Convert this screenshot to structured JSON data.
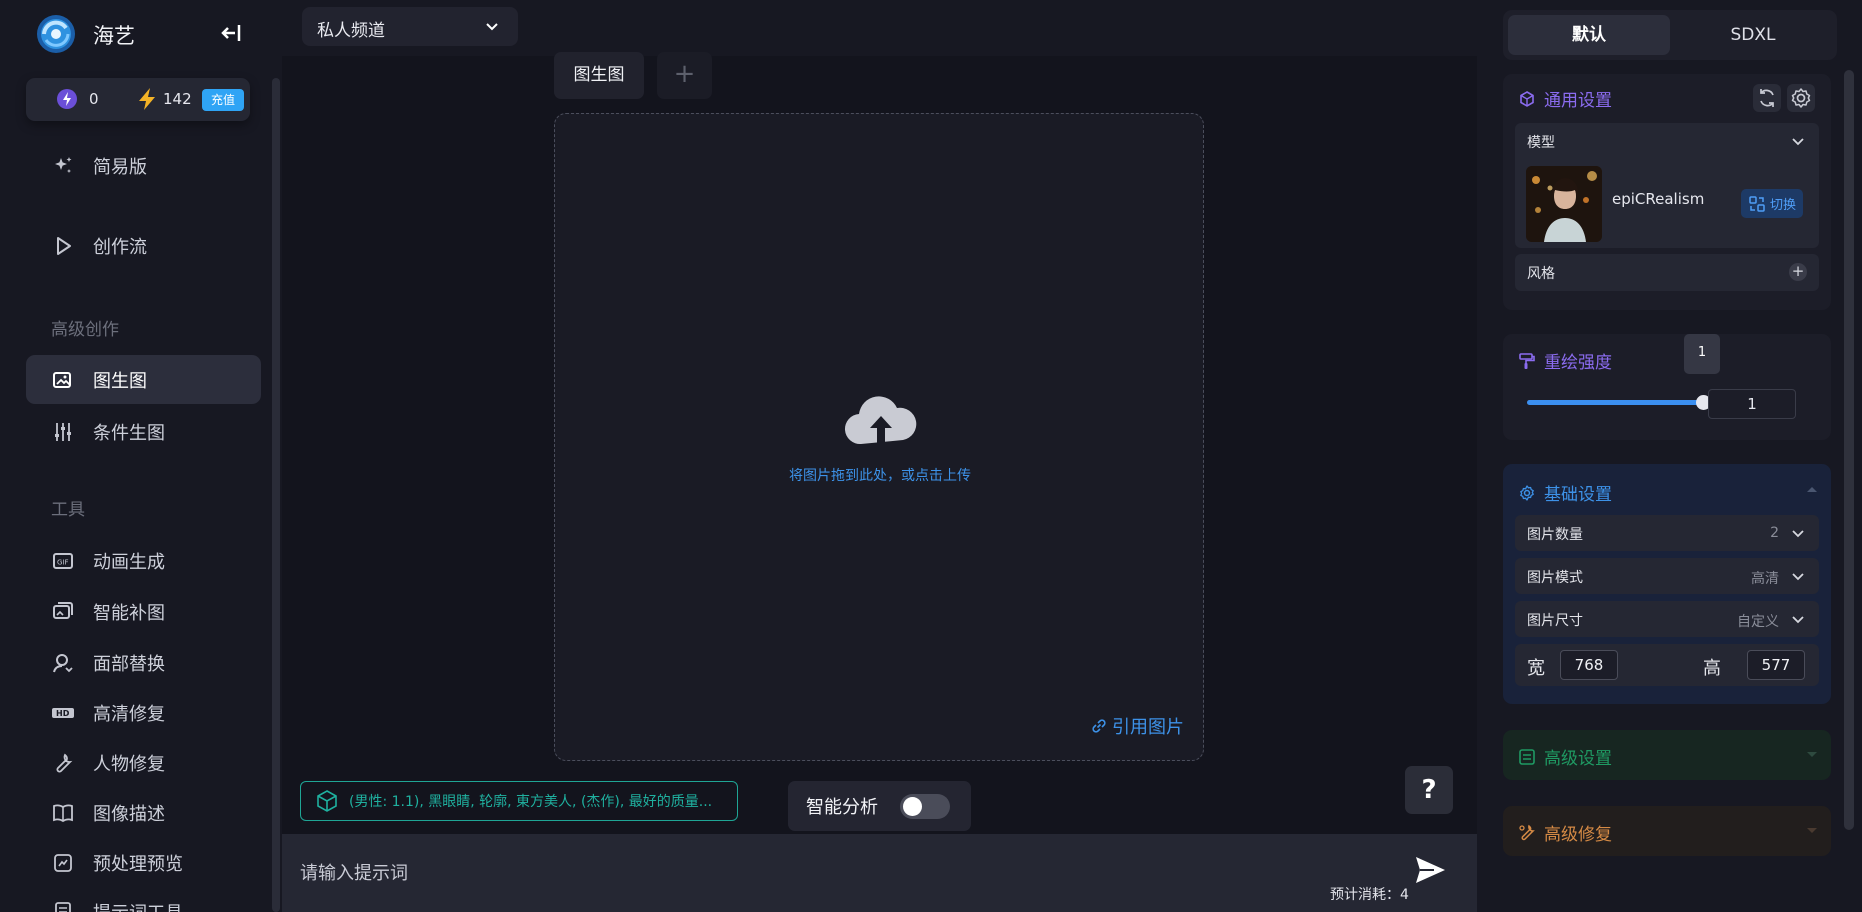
{
  "brand": {
    "name": "海艺"
  },
  "balance": {
    "energy": "0",
    "lightning": "142",
    "recharge_label": "充值"
  },
  "nav": {
    "items": [
      {
        "label": "简易版",
        "icon": "sparkle-icon"
      },
      {
        "label": "创作流",
        "icon": "play-icon"
      }
    ],
    "section_advanced": "高级创作",
    "advanced": [
      {
        "label": "图生图",
        "icon": "image-edit-icon",
        "active": true
      },
      {
        "label": "条件生图",
        "icon": "sliders-icon"
      }
    ],
    "section_tools": "工具",
    "tools": [
      {
        "label": "动画生成",
        "icon": "gif-icon"
      },
      {
        "label": "智能补图",
        "icon": "images-icon"
      },
      {
        "label": "面部替换",
        "icon": "face-icon"
      },
      {
        "label": "高清修复",
        "icon": "hd-icon"
      },
      {
        "label": "人物修复",
        "icon": "wrench-icon"
      },
      {
        "label": "图像描述",
        "icon": "book-icon"
      },
      {
        "label": "预处理预览",
        "icon": "preview-icon"
      },
      {
        "label": "提示词工具",
        "icon": "prompt-tool-icon"
      }
    ]
  },
  "main": {
    "channel": "私人频道",
    "tab_label": "图生图",
    "tab_add": "+",
    "upload_text": "将图片拖到此处，或点击上传",
    "ref_image_label": "引用图片",
    "prompt_tag": "(男性: 1.1), 黑眼睛, 轮廓, 東方美人, (杰作), 最好的质量...",
    "smart_label": "智能分析",
    "help_label": "?",
    "prompt_placeholder": "请输入提示词",
    "cost_label": "预计消耗：4"
  },
  "panel": {
    "modes": [
      "默认",
      "SDXL"
    ],
    "general": {
      "title": "通用设置",
      "model_label": "模型",
      "model_name": "epiCRealism",
      "switch_label": "切换",
      "style_label": "风格"
    },
    "redraw": {
      "title": "重绘强度",
      "value": "1",
      "tooltip": "1",
      "level": 1.0
    },
    "basic": {
      "title": "基础设置",
      "count_label": "图片数量",
      "count_value": "2",
      "mode_label": "图片模式",
      "mode_value": "高清",
      "size_label": "图片尺寸",
      "size_value": "自定义",
      "width_label": "宽",
      "width_value": "768",
      "height_label": "高",
      "height_value": "577"
    },
    "advanced": {
      "title": "高级设置"
    },
    "repair": {
      "title": "高级修复"
    }
  },
  "colors": {
    "accent": "#2fa4f5",
    "purple": "#8b6cf0",
    "link_blue": "#3d92e8",
    "teal": "#1fb09f",
    "green": "#1f9a63",
    "orange": "#d58a45"
  }
}
